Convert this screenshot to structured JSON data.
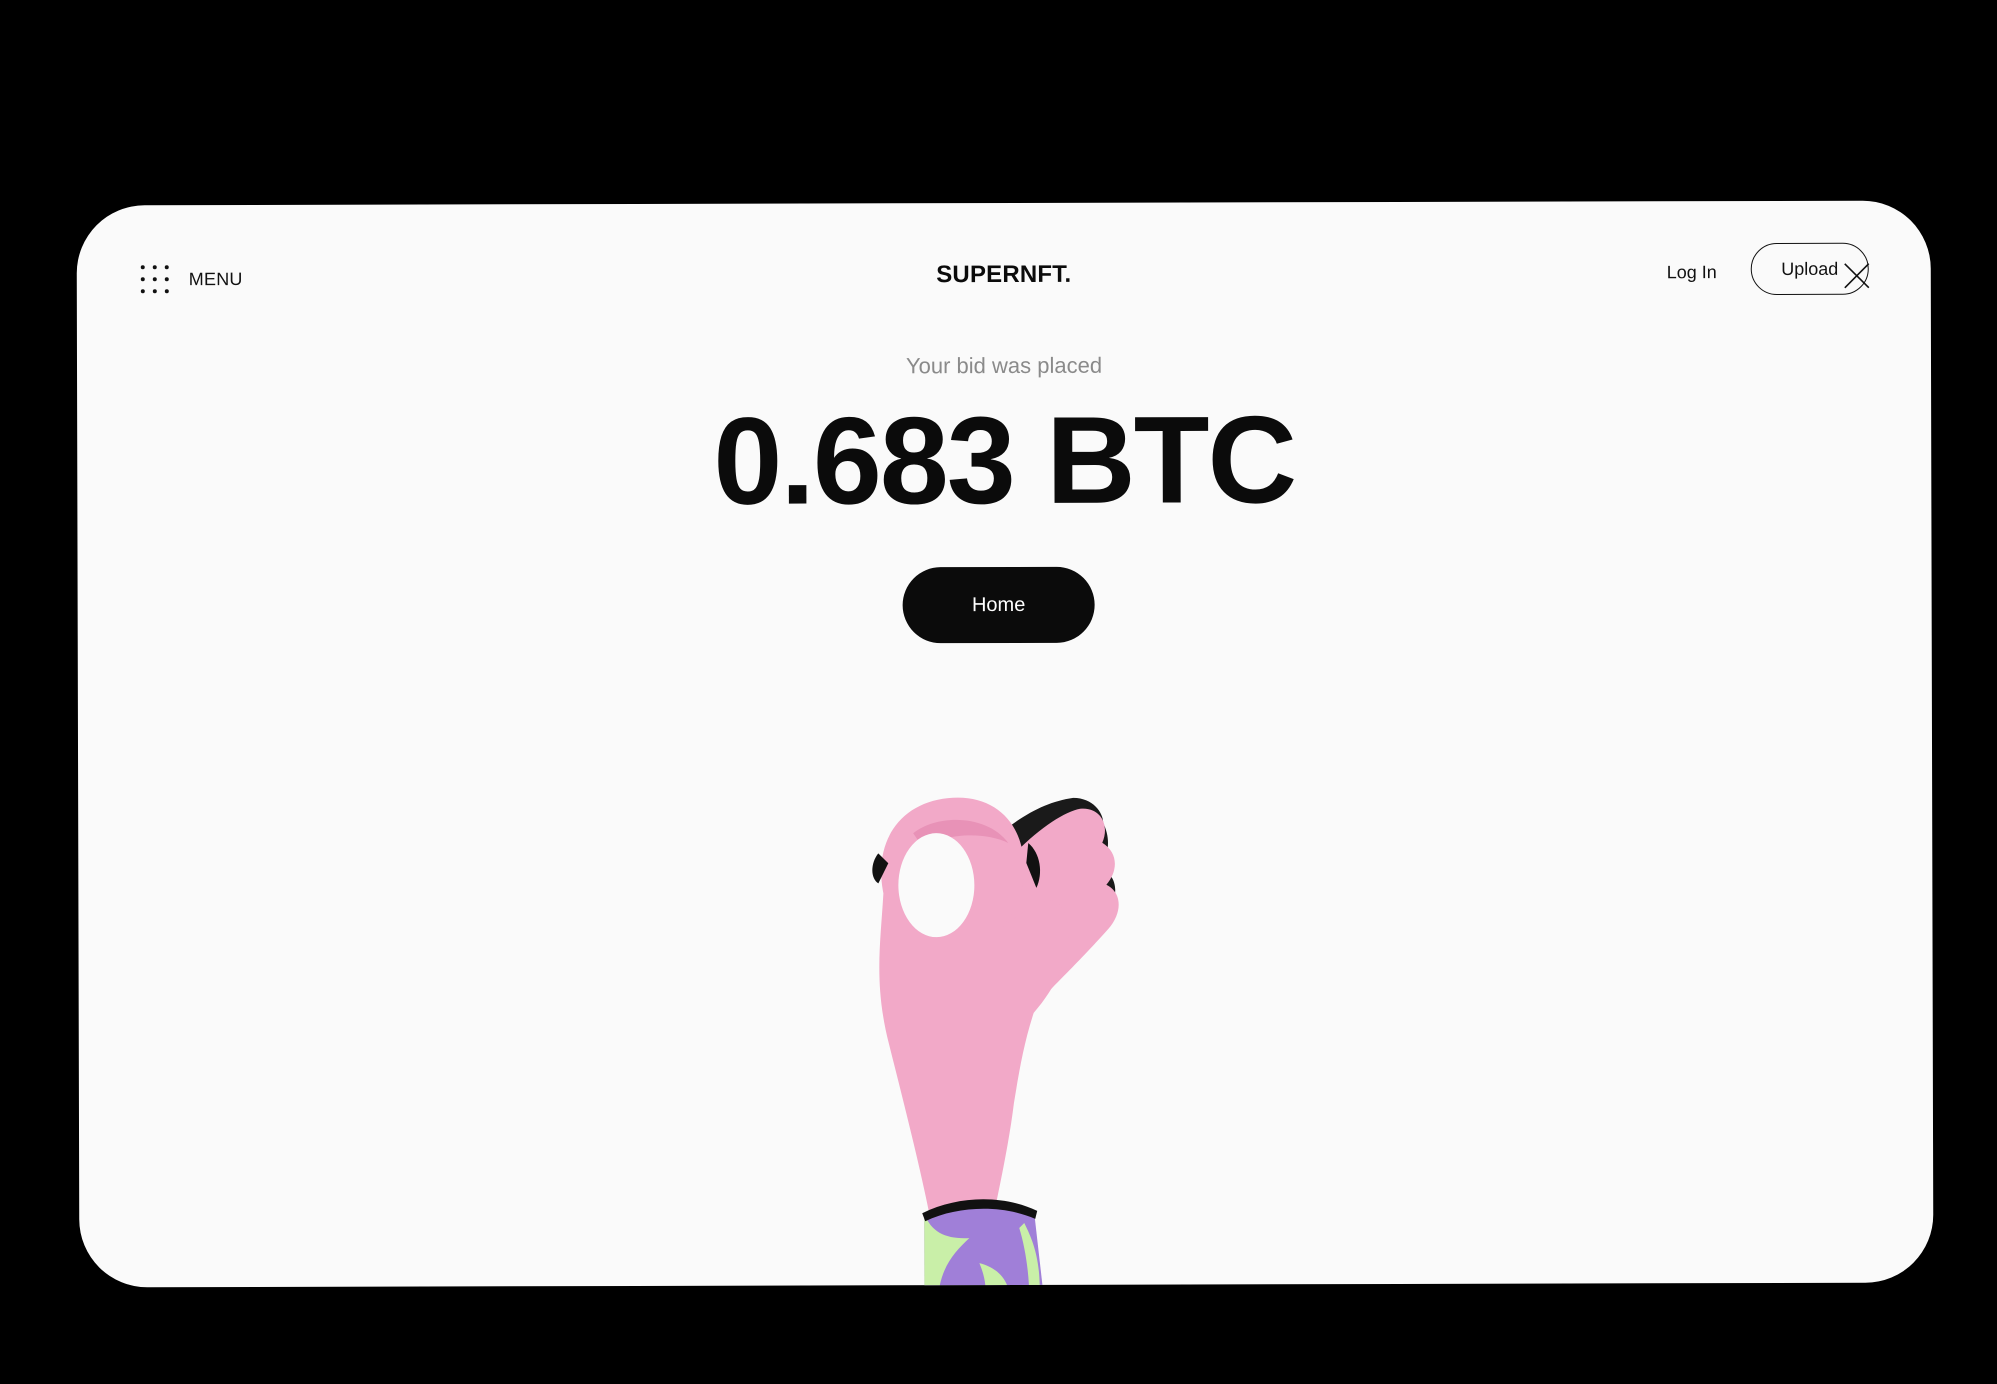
{
  "header": {
    "menu_label": "MENU",
    "logo": "SUPERNFT.",
    "login_label": "Log In",
    "upload_label": "Upload"
  },
  "main": {
    "subtitle": "Your bid was placed",
    "amount": "0.683 BTC",
    "home_label": "Home"
  },
  "icons": {
    "menu": "grid-dots-icon",
    "close": "close-icon"
  },
  "colors": {
    "background": "#000000",
    "card": "#fafafa",
    "primary": "#0b0b0b",
    "hand": "#f2a9c8",
    "sleeve": "#a07fd8",
    "sleeve_pattern": "#c9efa8"
  }
}
